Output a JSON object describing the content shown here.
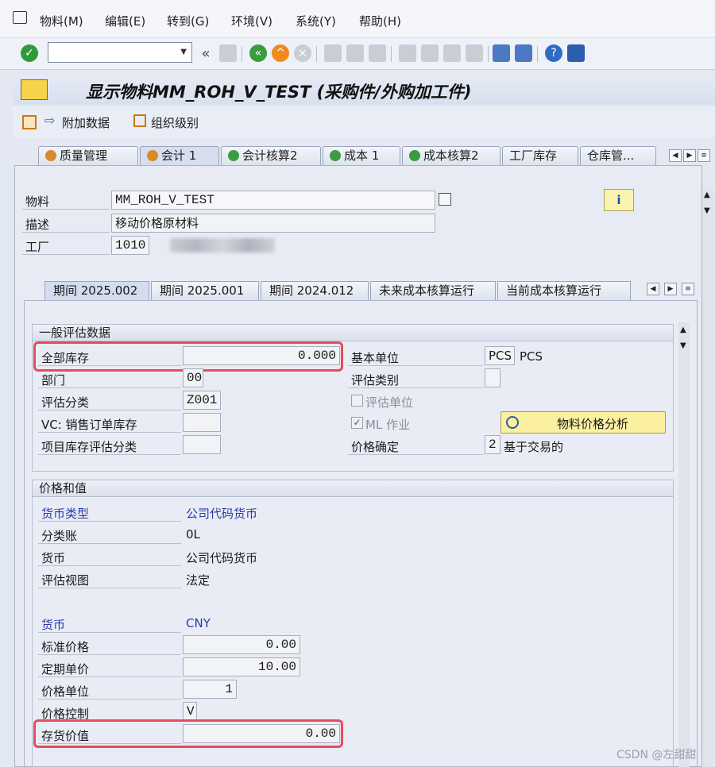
{
  "menu": {
    "items": [
      "物料(M)",
      "编辑(E)",
      "转到(G)",
      "环境(V)",
      "系统(Y)",
      "帮助(H)"
    ]
  },
  "title": "显示物料MM_ROH_V_TEST (采购件/外购加工件)",
  "app_toolbar": {
    "additional_data": "附加数据",
    "org_levels": "组织级别"
  },
  "main_tabs": [
    "质量管理",
    "会计 1",
    "会计核算2",
    "成本 1",
    "成本核算2",
    "工厂库存",
    "仓库管..."
  ],
  "header": {
    "material_label": "物料",
    "material_value": "MM_ROH_V_TEST",
    "description_label": "描述",
    "description_value": "移动价格原材料",
    "plant_label": "工厂",
    "plant_value": "1010"
  },
  "sub_tabs": [
    "期间 2025.002",
    "期间 2025.001",
    "期间 2024.012",
    "未来成本核算运行",
    "当前成本核算运行"
  ],
  "general_valuation": {
    "title": "一般评估数据",
    "total_stock_label": "全部库存",
    "total_stock_value": "0.000",
    "base_unit_label": "基本单位",
    "base_unit_value": "PCS",
    "base_unit_text": "PCS",
    "division_label": "部门",
    "division_value": "00",
    "valuation_category_label": "评估类别",
    "valuation_class_label": "评估分类",
    "valuation_class_value": "Z001",
    "valuated_unit_label": "评估单位",
    "vc_sales_label": "VC: 销售订单库存",
    "ml_label": "ML 作业",
    "material_price_analysis": "物料价格分析",
    "project_stock_label": "项目库存评估分类",
    "price_determination_label": "价格确定",
    "price_determination_value": "2",
    "price_determination_text": "基于交易的"
  },
  "prices_values": {
    "title": "价格和值",
    "currency_type_label": "货币类型",
    "currency_type_value": "公司代码货币",
    "ledger_label": "分类账",
    "ledger_value": "0L",
    "currency_label": "货币",
    "currency_value": "公司代码货币",
    "valuation_view_label": "评估视图",
    "valuation_view_value": "法定",
    "currency2_label": "货币",
    "currency2_value": "CNY",
    "standard_price_label": "标准价格",
    "standard_price_value": "0.00",
    "periodic_unit_price_label": "定期单价",
    "periodic_unit_price_value": "10.00",
    "price_unit_label": "价格单位",
    "price_unit_value": "1",
    "price_control_label": "价格控制",
    "price_control_value": "V",
    "inventory_value_label": "存货价值",
    "inventory_value_value": "0.00"
  },
  "watermark": "CSDN @左甜甜",
  "colors": {
    "highlight": "#e84b5c",
    "blue_label": "#2a3aa8"
  }
}
